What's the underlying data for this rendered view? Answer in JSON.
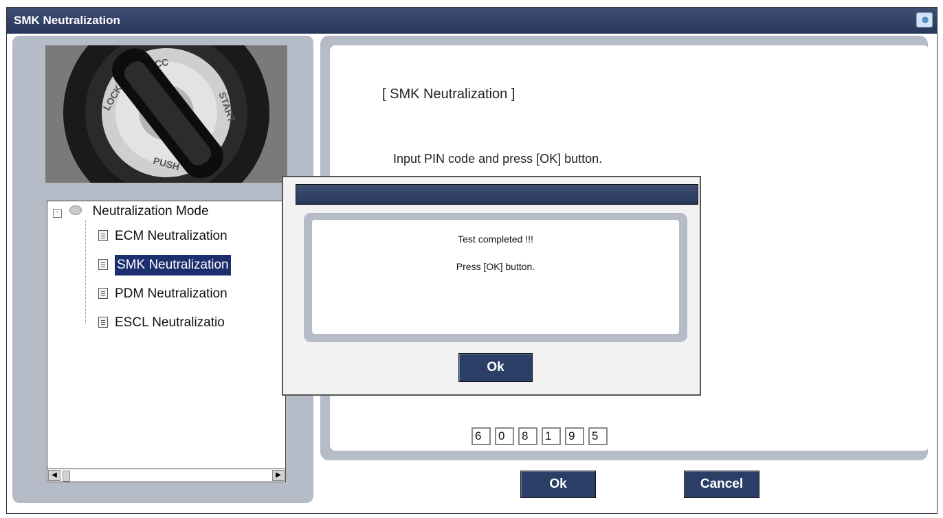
{
  "window": {
    "title": "SMK Neutralization",
    "accent": "#2b3e66"
  },
  "tree": {
    "root_label": "Neutralization Mode",
    "items": [
      {
        "label": "ECM Neutralization",
        "selected": false
      },
      {
        "label": "SMK Neutralization",
        "selected": true
      },
      {
        "label": "PDM Neutralization",
        "selected": false
      },
      {
        "label": "ESCL Neutralizatio",
        "selected": false
      }
    ],
    "scroll_left": "◀",
    "scroll_right": "▶"
  },
  "key_image": {
    "labels": [
      "LOCK",
      "ACC",
      "START",
      "PUSH"
    ]
  },
  "main": {
    "heading": "[ SMK Neutralization ]",
    "instruction": "Input PIN code and press [OK] button.",
    "pin_digits": [
      "6",
      "0",
      "8",
      "1",
      "9",
      "5"
    ],
    "ok_label": "Ok",
    "cancel_label": "Cancel"
  },
  "dialog": {
    "line1": "Test completed !!!",
    "line2": "Press [OK] button.",
    "ok_label": "Ok"
  }
}
